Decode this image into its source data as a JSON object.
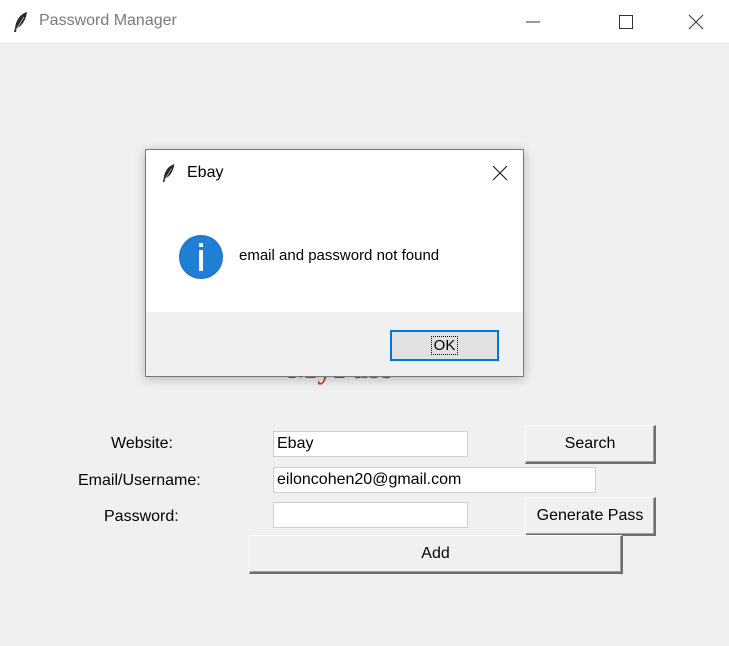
{
  "window": {
    "title": "Password Manager",
    "icon": "feather-icon",
    "controls": [
      "minimize-icon",
      "maximize-icon",
      "close-icon"
    ]
  },
  "logo": {
    "text": "MyPass",
    "color": "#c63a33"
  },
  "form": {
    "website_label": "Website:",
    "website_value": "Ebay",
    "email_label": "Email/Username:",
    "email_value": "eiloncohen20@gmail.com",
    "password_label": "Password:",
    "password_value": "",
    "search_button": "Search",
    "generate_button": "Generate Pass",
    "add_button": "Add"
  },
  "dialog": {
    "title": "Ebay",
    "icon": "info-icon",
    "message": "email and password not found",
    "ok_button": "OK",
    "accent": "#0078d7"
  }
}
